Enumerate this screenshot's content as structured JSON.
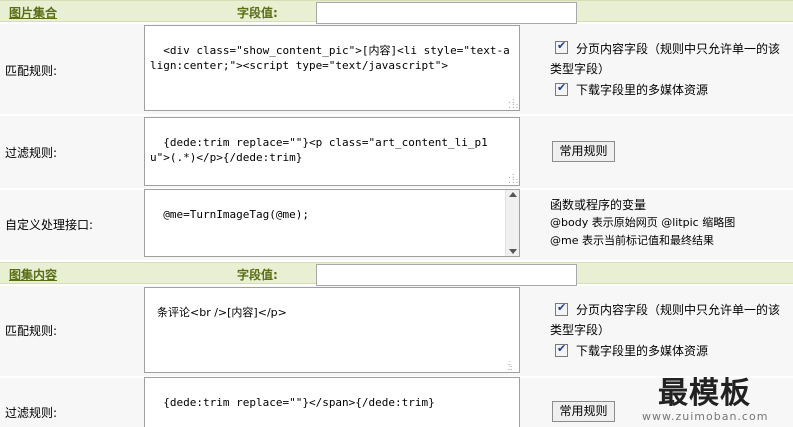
{
  "section1": {
    "title": "图片集合",
    "field_label": "字段值:",
    "field_value": "",
    "match": {
      "label": "匹配规则:",
      "value": "<div class=\"show_content_pic\">[内容]<li style=\"text-align:center;\"><script type=\"text/javascript\">",
      "option1": "分页内容字段（规则中只允许单一的该类型字段）",
      "option2": "下载字段里的多媒体资源"
    },
    "filter": {
      "label": "过滤规则:",
      "value": "{dede:trim replace=\"\"}<p class=\"art_content_li_p1 u\">(.*)</p>{/dede:trim}",
      "button": "常用规则"
    },
    "custom": {
      "label": "自定义处理接口:",
      "value": "@me=TurnImageTag(@me);",
      "note1": "函数或程序的变量",
      "note2": "@body 表示原始网页 @litpic 缩略图",
      "note3": "@me 表示当前标记值和最终结果"
    }
  },
  "section2": {
    "title": "图集内容",
    "field_label": "字段值:",
    "field_value": "",
    "match": {
      "label": "匹配规则:",
      "value": "条评论<br />[内容]</p>",
      "option1": "分页内容字段（规则中只允许单一的该类型字段）",
      "option2": "下载字段里的多媒体资源"
    },
    "filter": {
      "label": "过滤规则:",
      "value": "{dede:trim replace=\"\"}</span>{/dede:trim}",
      "button": "常用规则"
    }
  },
  "watermark": {
    "brand": "最模板",
    "url": "www.zuimoban.com"
  }
}
